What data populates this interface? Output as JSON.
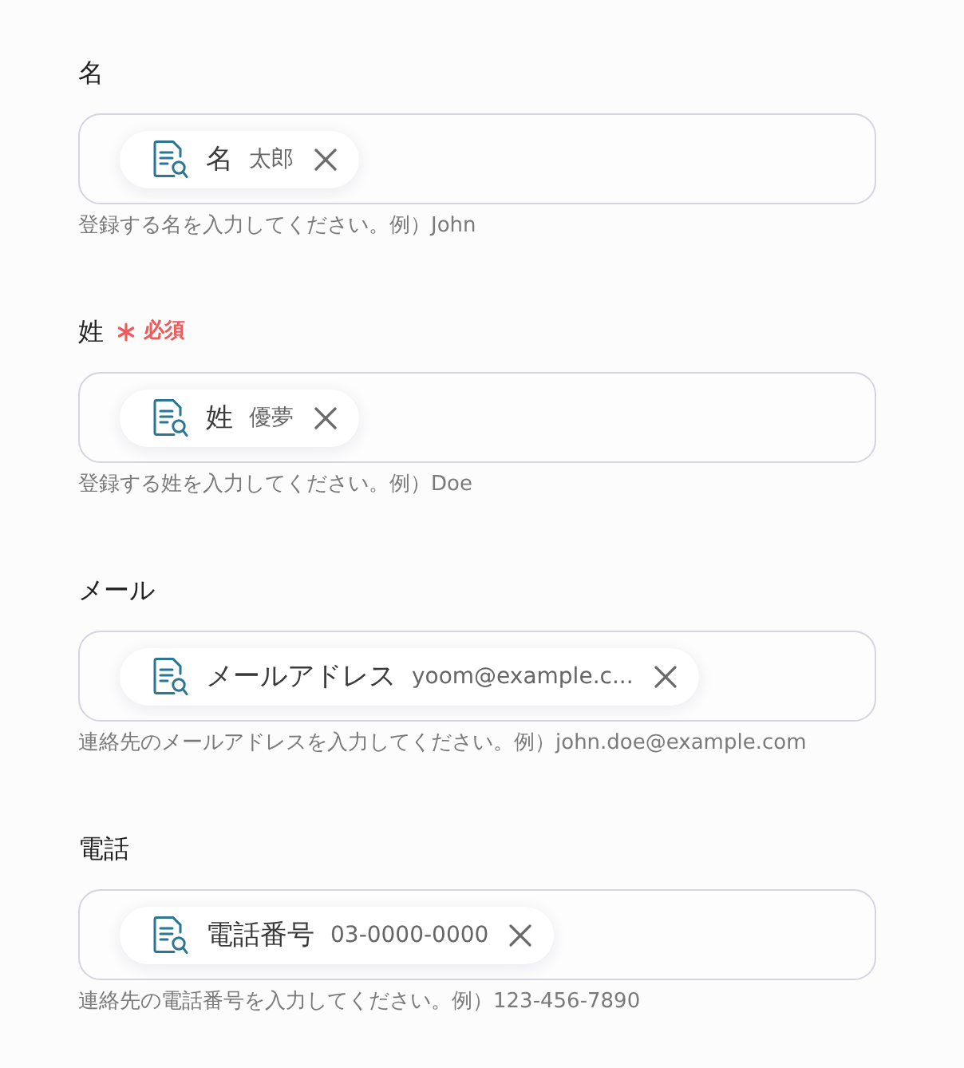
{
  "fields": [
    {
      "label": "名",
      "required": false,
      "chip": {
        "label": "名",
        "value": "太郎"
      },
      "hint": "登録する名を入力してください。例）John"
    },
    {
      "label": "姓",
      "required": true,
      "required_text": "必須",
      "chip": {
        "label": "姓",
        "value": "優夢"
      },
      "hint": "登録する姓を入力してください。例）Doe"
    },
    {
      "label": "メール",
      "required": false,
      "chip": {
        "label": "メールアドレス",
        "value": "yoom@example.c..."
      },
      "hint": "連絡先のメールアドレスを入力してください。例）john.doe@example.com"
    },
    {
      "label": "電話",
      "required": false,
      "chip": {
        "label": "電話番号",
        "value": "03-0000-0000"
      },
      "hint": "連絡先の電話番号を入力してください。例）123-456-7890"
    }
  ]
}
